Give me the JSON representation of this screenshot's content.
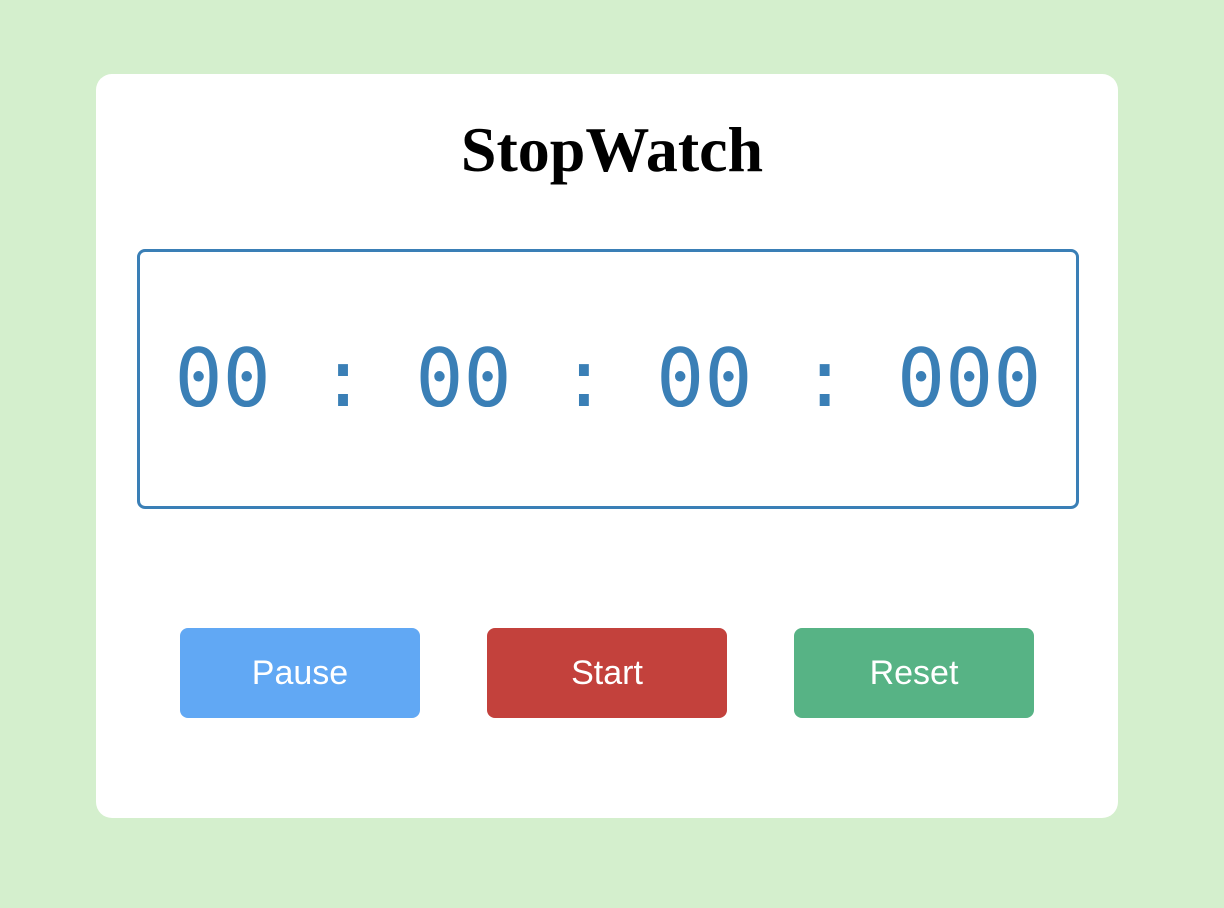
{
  "app": {
    "title": "StopWatch"
  },
  "display": {
    "time": "00 : 00 : 00 : 000",
    "color": "#3a7fb6"
  },
  "buttons": {
    "pause": {
      "label": "Pause",
      "color": "#61a8f4"
    },
    "start": {
      "label": "Start",
      "color": "#c3413c"
    },
    "reset": {
      "label": "Reset",
      "color": "#57b385"
    }
  },
  "theme": {
    "background": "#d4efcd",
    "card": "#ffffff"
  }
}
